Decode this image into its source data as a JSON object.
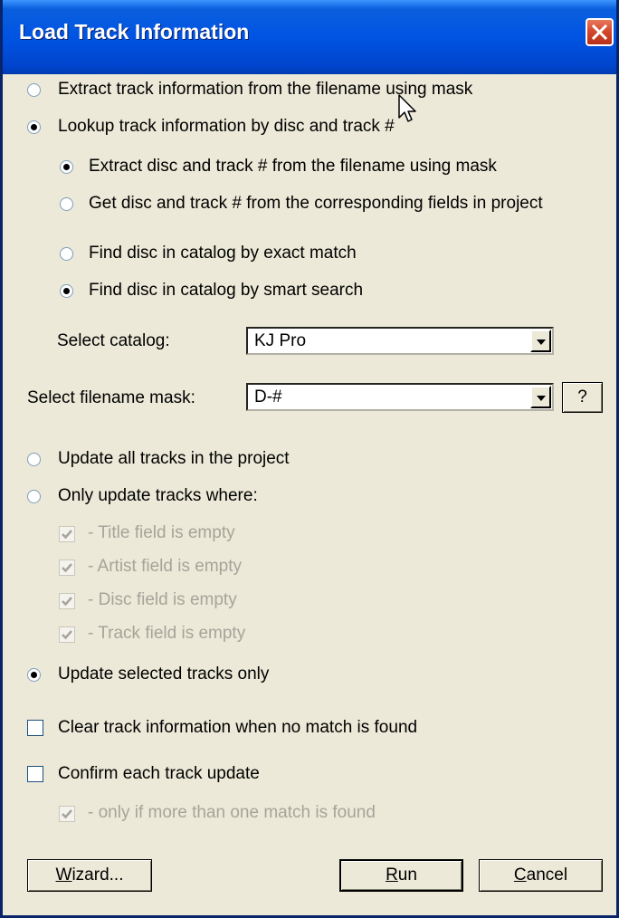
{
  "window": {
    "title": "Load Track Information"
  },
  "source": {
    "extract_label": "Extract track information from the filename using mask",
    "lookup_label": "Lookup track information by disc and track #",
    "selected": "lookup"
  },
  "disc_track": {
    "extract_label": "Extract disc and track # from the filename using mask",
    "fields_label": "Get disc and track # from the corresponding fields in project",
    "selected": "extract"
  },
  "catalog_find": {
    "exact_label": "Find disc in catalog by exact match",
    "smart_label": "Find disc in catalog by smart search",
    "selected": "smart"
  },
  "select_catalog": {
    "label": "Select catalog:",
    "value": "KJ Pro"
  },
  "select_mask": {
    "label": "Select filename mask:",
    "value": "D-#",
    "help_label": "?"
  },
  "update": {
    "all_label": "Update all tracks in the project",
    "only_label": "Only update tracks where:",
    "selected_label": "Update selected tracks only",
    "selected": "selected_only"
  },
  "conditions": [
    {
      "label": "- Title field is empty",
      "checked": true,
      "enabled": false
    },
    {
      "label": "- Artist field is empty",
      "checked": true,
      "enabled": false
    },
    {
      "label": "- Disc field is empty",
      "checked": true,
      "enabled": false
    },
    {
      "label": "- Track field is empty",
      "checked": true,
      "enabled": false
    }
  ],
  "clear_info": {
    "label": "Clear track information when no match is found",
    "checked": false
  },
  "confirm": {
    "label": "Confirm each track update",
    "checked": false
  },
  "confirm_sub": {
    "label": "- only if more than one match is found",
    "checked": true,
    "enabled": false
  },
  "buttons": {
    "wizard_mnemonic": "W",
    "wizard_rest": "izard...",
    "run_mnemonic": "R",
    "run_rest": "un",
    "cancel_mnemonic": "C",
    "cancel_rest": "ancel"
  },
  "colors": {
    "titlebar": "#0054e3",
    "dialog_bg": "#ece9d8",
    "close_button": "#d2452a"
  }
}
